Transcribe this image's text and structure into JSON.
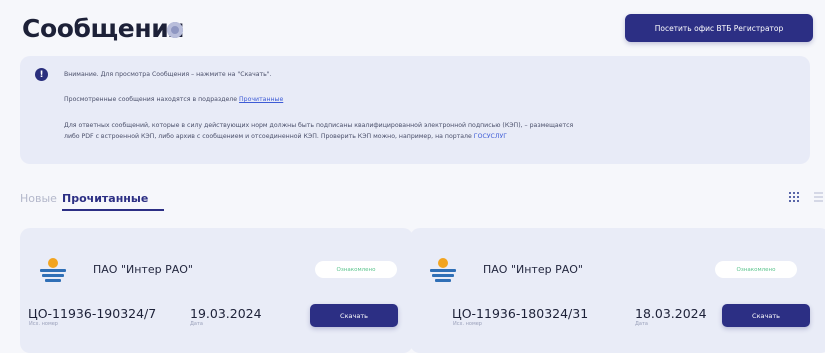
{
  "header": {
    "title": "Сообщения",
    "visit_button": "Посетить офис ВТБ Регистратор"
  },
  "notice": {
    "line1": "Внимание. Для просмотра Сообщения – нажмите на \"Скачать\".",
    "line2_prefix": "Просмотренные сообщения находятся в подразделе",
    "line2_link": "Прочитанные",
    "line3": "Для ответных сообщений, которые в силу действующих норм должны быть подписаны квалифицированной электронной подписью (КЭП), – размещается",
    "line4_prefix": "либо PDF с встроенной КЭП, либо архив с сообщением и отсоединенной КЭП. Проверить КЭП можно, например, на портале",
    "line4_link": "ГОСУСЛУГ"
  },
  "tabs": {
    "new": "Новые",
    "read": "Прочитанные"
  },
  "cards": [
    {
      "org": "ПАО \"Интер РАО\"",
      "status": "Ознакомлено",
      "doc_number": "ЦО-11936-190324/7",
      "doc_number_label": "Исх. номер",
      "date": "19.03.2024",
      "date_label": "Дата",
      "button": "Скачать"
    },
    {
      "org": "ПАО \"Интер РАО\"",
      "status": "Ознакомлено",
      "doc_number": "ЦО-11936-180324/31",
      "doc_number_label": "Исх. номер",
      "date": "18.03.2024",
      "date_label": "Дата",
      "button": "Скачать"
    }
  ],
  "colors": {
    "accent": "#2c2f84",
    "status_text": "#5bc48d",
    "link": "#3d5bd6"
  }
}
